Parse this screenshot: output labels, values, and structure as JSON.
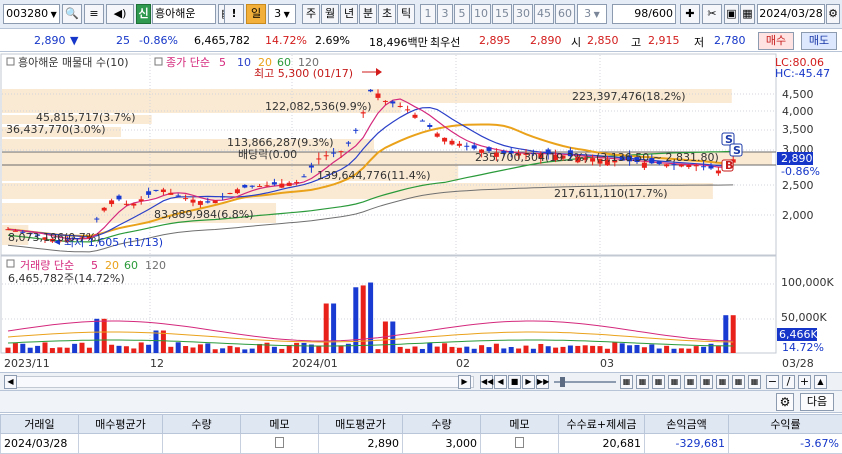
{
  "toolbar": {
    "code": "003280",
    "credit_badge": "신",
    "name": "흥아해운",
    "alert": "!",
    "period_day": "일",
    "period_num": "3",
    "period_week": "주",
    "period_month": "월",
    "period_year": "년",
    "period_min": "분",
    "period_tick": "초",
    "period_tic": "틱",
    "intervals": [
      "1",
      "3",
      "5",
      "10",
      "15",
      "30",
      "45",
      "60"
    ],
    "interval_value": "3",
    "count": "98",
    "count_total": "/600",
    "date": "2024/03/28"
  },
  "quote": {
    "price": "2,890",
    "change_arrow": "▼",
    "change": "25",
    "change_rate": "-0.86%",
    "volume": "6,465,782",
    "turnover": "14.72%",
    "rate2": "2.69%",
    "amount": "18,496백만",
    "bid_label": "최우선",
    "bid1": "2,895",
    "bid2": "2,890",
    "open_label": "시",
    "open": "2,850",
    "high_label": "고",
    "high": "2,915",
    "low_label": "저",
    "low": "2,780",
    "buy_label": "매수",
    "sell_label": "매도"
  },
  "chart_data": {
    "type": "candlestick",
    "title": "흥아해운 매물대 수(10)",
    "ma_label": "종가 단순",
    "ma_periods": [
      "5",
      "10",
      "20",
      "60",
      "120"
    ],
    "ma_colors": [
      "#d4287c",
      "#2b40c8",
      "#eaa21b",
      "#2a9a3a",
      "#707070"
    ],
    "lc_label": "LC:80.06",
    "hc_label": "HC:-45.47",
    "price_axis": [
      "4,500",
      "4,000",
      "3,500",
      "3,000",
      "2,500",
      "2,000"
    ],
    "current_price": "2,890",
    "current_rate": "-0.86%",
    "high_note": "최고 5,300 (01/17)",
    "low_note": "최저 1,605 (11/13)",
    "dividend_note": "배당락(0.00",
    "volume_profile": [
      {
        "label": "223,397,476(18.2%)",
        "value": 223397476
      },
      {
        "label": "122,082,536(9.9%)",
        "value": 122082536
      },
      {
        "label": "45,815,717(3.7%)",
        "value": 45815717
      },
      {
        "label": "36,437,770(3.0%)",
        "value": 36437770
      },
      {
        "label": "113,866,287(9.3%)",
        "value": 113866287
      },
      {
        "label": "235,700,304(19.2%)",
        "value": 235700304
      },
      {
        "label": "139,644,776(11.4%)",
        "value": 139644776
      },
      {
        "label": "217,611,110(17.7%)",
        "value": 217611110
      },
      {
        "label": "83,889,984(6.8%)",
        "value": 83889984
      },
      {
        "label": "8,073,196(0.7%)",
        "value": 8073196
      }
    ],
    "range_note": "(3,136.50 ~ 2,831.80)",
    "volume_title": "거래량 단순",
    "volume_ma_periods": [
      "5",
      "20",
      "60",
      "120"
    ],
    "volume_now": "6,465,782주(14.72%)",
    "volume_axis": [
      "100,000K",
      "50,000K"
    ],
    "volume_current": "6,466K",
    "volume_rate": "14.72%",
    "x_labels": [
      "2023/11",
      "12",
      "2024/01",
      "02",
      "03",
      "03/28"
    ],
    "signals": [
      "S",
      "S",
      "B"
    ]
  },
  "trade_panel": {
    "next_label": "다음",
    "headers": [
      "거래일",
      "매수평균가",
      "수량",
      "메모",
      "매도평균가",
      "수량",
      "메모",
      "수수료+제세금",
      "손익금액",
      "수익률"
    ],
    "row": {
      "date": "2024/03/28",
      "buy_avg": "",
      "buy_qty": "",
      "sell_avg": "2,890",
      "sell_qty": "3,000",
      "fee": "20,681",
      "pnl": "-329,681",
      "rate": "-3.67%"
    }
  }
}
